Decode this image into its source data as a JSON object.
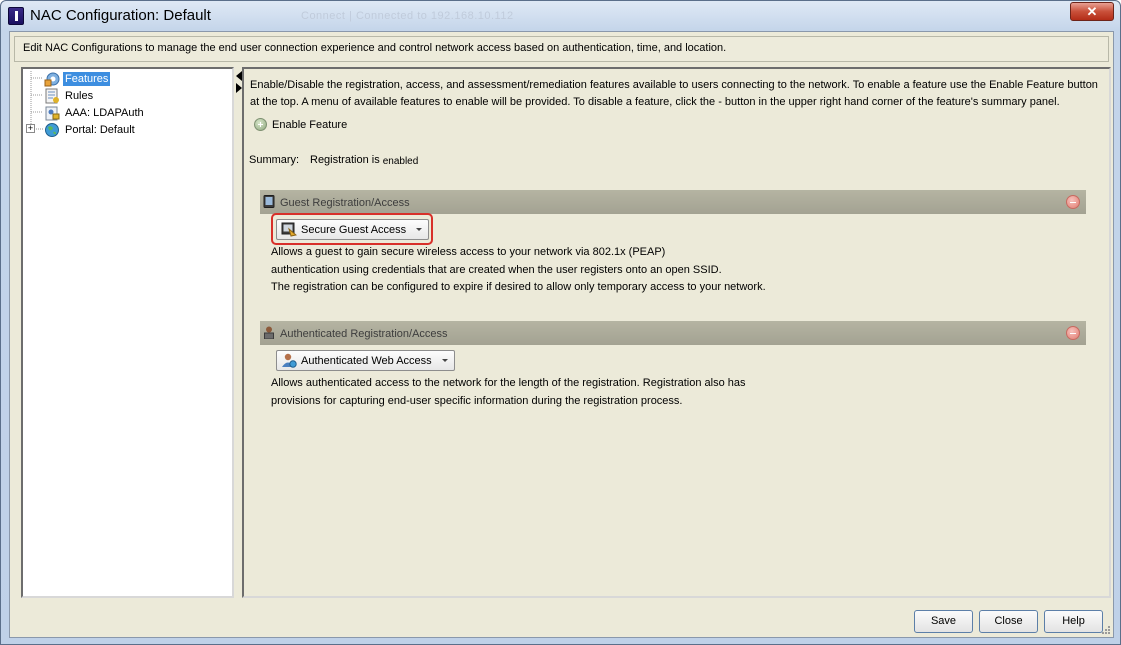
{
  "window": {
    "title": "NAC Configuration: Default",
    "title_ghost": "Connect | Connected to 192.168.10.112",
    "close_label": "✕"
  },
  "description": "Edit NAC Configurations to manage the end user connection experience and control network access based on authentication, time, and location.",
  "tree": {
    "items": [
      {
        "label": "Features",
        "icon": "features-icon",
        "selected": true
      },
      {
        "label": "Rules",
        "icon": "rules-icon"
      },
      {
        "label": "AAA: LDAPAuth",
        "icon": "aaa-icon"
      },
      {
        "label": "Portal: Default",
        "icon": "globe-icon",
        "expandable": true
      }
    ],
    "expander_label": "+"
  },
  "main": {
    "intro_line1": "Enable/Disable the registration, access, and assessment/remediation features available to users connecting to the network. To enable a feature use the Enable Feature button",
    "intro_line2": "at the top. A menu of available features to enable will be provided. To disable a feature, click the - button in the upper right hand corner of the feature's summary panel.",
    "enable_feature_label": "Enable Feature",
    "summary": {
      "label": "Summary:",
      "value": "Registration is",
      "status": "enabled"
    },
    "features": [
      {
        "header": "Guest Registration/Access",
        "header_icon": "tablet-icon",
        "dropdown_label": "Secure Guest Access",
        "dropdown_icon": "secure-guest-icon",
        "highlighted": true,
        "desc": [
          "Allows a guest to gain secure wireless access to your network via 802.1x (PEAP)",
          "authentication using credentials that are created when the user registers onto an open SSID.",
          "The registration can be configured to expire if desired to allow only temporary access to your network."
        ]
      },
      {
        "header": "Authenticated Registration/Access",
        "header_icon": "user-lock-icon",
        "dropdown_label": "Authenticated Web Access",
        "dropdown_icon": "user-globe-icon",
        "highlighted": false,
        "desc": [
          "Allows authenticated access to the network for the length of the registration. Registration also has",
          "provisions for capturing end-user specific information during the registration process."
        ]
      }
    ]
  },
  "footer": {
    "save_label": "Save",
    "close_label": "Close",
    "help_label": "Help"
  }
}
